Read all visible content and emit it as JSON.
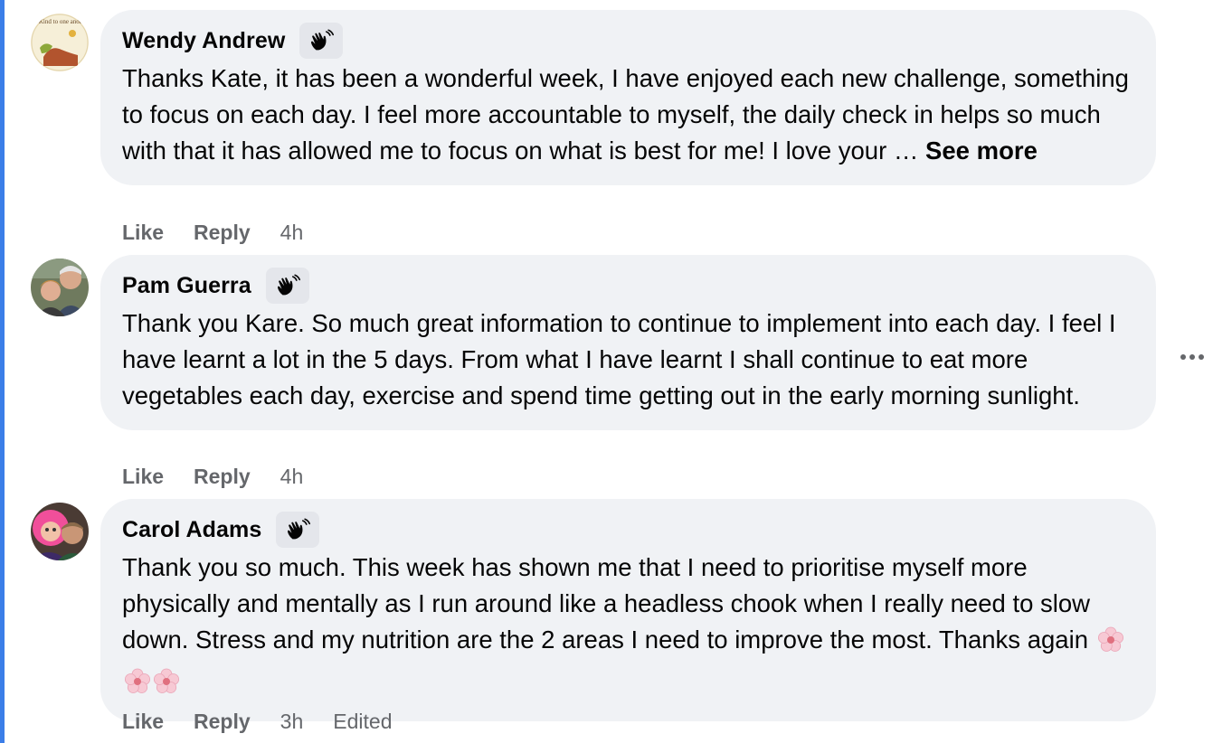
{
  "comments": [
    {
      "author": "Wendy Andrew",
      "text": "Thanks Kate, it has been a wonderful week, I have enjoyed each new challenge, something to focus on each day. I feel more accountable to myself, the daily check in helps so much with that it has allowed me to focus on what is best for me! I love your … ",
      "see_more": "See more",
      "like": "Like",
      "reply": "Reply",
      "time": "4h",
      "avatar_text": "Be Kind to one another"
    },
    {
      "author": "Pam Guerra",
      "text": "Thank you Kare. So much great information to continue to implement into each day. I feel I have learnt a lot in the 5 days. From what I have learnt I shall continue to eat more vegetables each day, exercise and spend time getting out in the early morning sunlight.",
      "like": "Like",
      "reply": "Reply",
      "time": "4h"
    },
    {
      "author": "Carol Adams",
      "text": "Thank you so much. This week has shown me that I need to prioritise myself more physically and mentally as I run around like a headless chook when I really need to slow down. Stress and my nutrition are the 2 areas I need to improve the most. Thanks again ",
      "emoji": [
        "cherry-blossom",
        "cherry-blossom",
        "cherry-blossom"
      ],
      "like": "Like",
      "reply": "Reply",
      "time": "3h",
      "edited": "Edited"
    }
  ],
  "badge_icon": "waving-hand-icon",
  "more_icon": "more-options-icon",
  "colors": {
    "bubble": "#f0f2f5",
    "meta": "#65676b",
    "accent_rule": "#3b7ee8"
  }
}
